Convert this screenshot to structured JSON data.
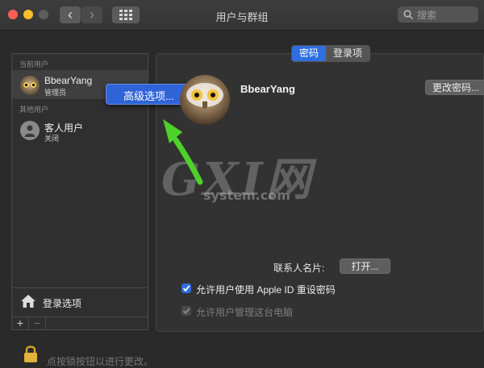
{
  "window": {
    "title": "用户与群组"
  },
  "search": {
    "placeholder": "搜索"
  },
  "sidebar": {
    "current_header": "当前用户",
    "current_user": {
      "name": "BbearYang",
      "role": "管理员"
    },
    "other_header": "其他用户",
    "guest_user": {
      "name": "客人用户",
      "status": "关闭"
    },
    "login_options": "登录选项",
    "add_label": "+",
    "remove_label": "−"
  },
  "context_menu": {
    "item": "高级选项..."
  },
  "tabs": [
    {
      "label": "密码",
      "active": true
    },
    {
      "label": "登录项",
      "active": false
    }
  ],
  "main": {
    "user_name": "BbearYang",
    "change_password": "更改密码...",
    "contact_card_label": "联系人名片:",
    "open_button": "打开...",
    "allow_apple_id_reset": {
      "label": "允许用户使用 Apple ID 重设密码",
      "checked": true
    },
    "allow_admin": {
      "label": "允许用户管理这台电脑",
      "checked": true,
      "disabled": true
    }
  },
  "watermark": {
    "logo": "GXI网",
    "domain": "system.com"
  },
  "footer": {
    "lock_text": "点按锁按钮以进行更改。"
  },
  "colors": {
    "accent": "#2f6de0",
    "arrow": "#4ed12a"
  }
}
